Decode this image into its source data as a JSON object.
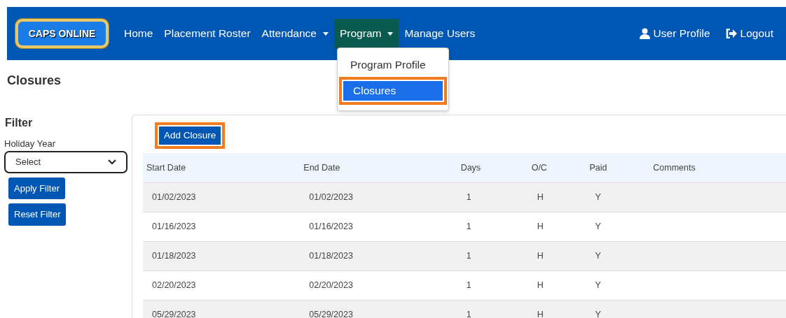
{
  "navbar": {
    "logo": "CAPS ONLINE",
    "items": [
      {
        "label": "Home",
        "dropdown": false,
        "selected": false
      },
      {
        "label": "Placement Roster",
        "dropdown": false,
        "selected": false
      },
      {
        "label": "Attendance",
        "dropdown": true,
        "selected": false
      },
      {
        "label": "Program",
        "dropdown": true,
        "selected": true
      },
      {
        "label": "Manage Users",
        "dropdown": false,
        "selected": false
      }
    ],
    "right_items": [
      {
        "label": "User Profile"
      },
      {
        "label": "Logout"
      }
    ]
  },
  "dropdown_menu": {
    "items": [
      {
        "label": "Program Profile",
        "selected": false,
        "highlighted": false
      },
      {
        "label": "Closures",
        "selected": true,
        "highlighted": true
      }
    ]
  },
  "page_title": "Closures",
  "filter": {
    "title": "Filter",
    "label": "Holiday Year",
    "select_value": "Select",
    "buttons": [
      "Apply Filter",
      "Reset Filter"
    ]
  },
  "add_button": {
    "label": "Add Closure",
    "highlighted": true
  },
  "table": {
    "columns": [
      "Start Date",
      "End Date",
      "Days",
      "O/C",
      "Paid",
      "Comments"
    ],
    "rows": [
      [
        "01/02/2023",
        "01/02/2023",
        "1",
        "H",
        "Y",
        ""
      ],
      [
        "01/16/2023",
        "01/16/2023",
        "1",
        "H",
        "Y",
        ""
      ],
      [
        "01/18/2023",
        "01/18/2023",
        "1",
        "H",
        "Y",
        ""
      ],
      [
        "02/20/2023",
        "02/20/2023",
        "1",
        "H",
        "Y",
        ""
      ],
      [
        "05/29/2023",
        "05/29/2023",
        "1",
        "H",
        "Y",
        ""
      ]
    ]
  }
}
